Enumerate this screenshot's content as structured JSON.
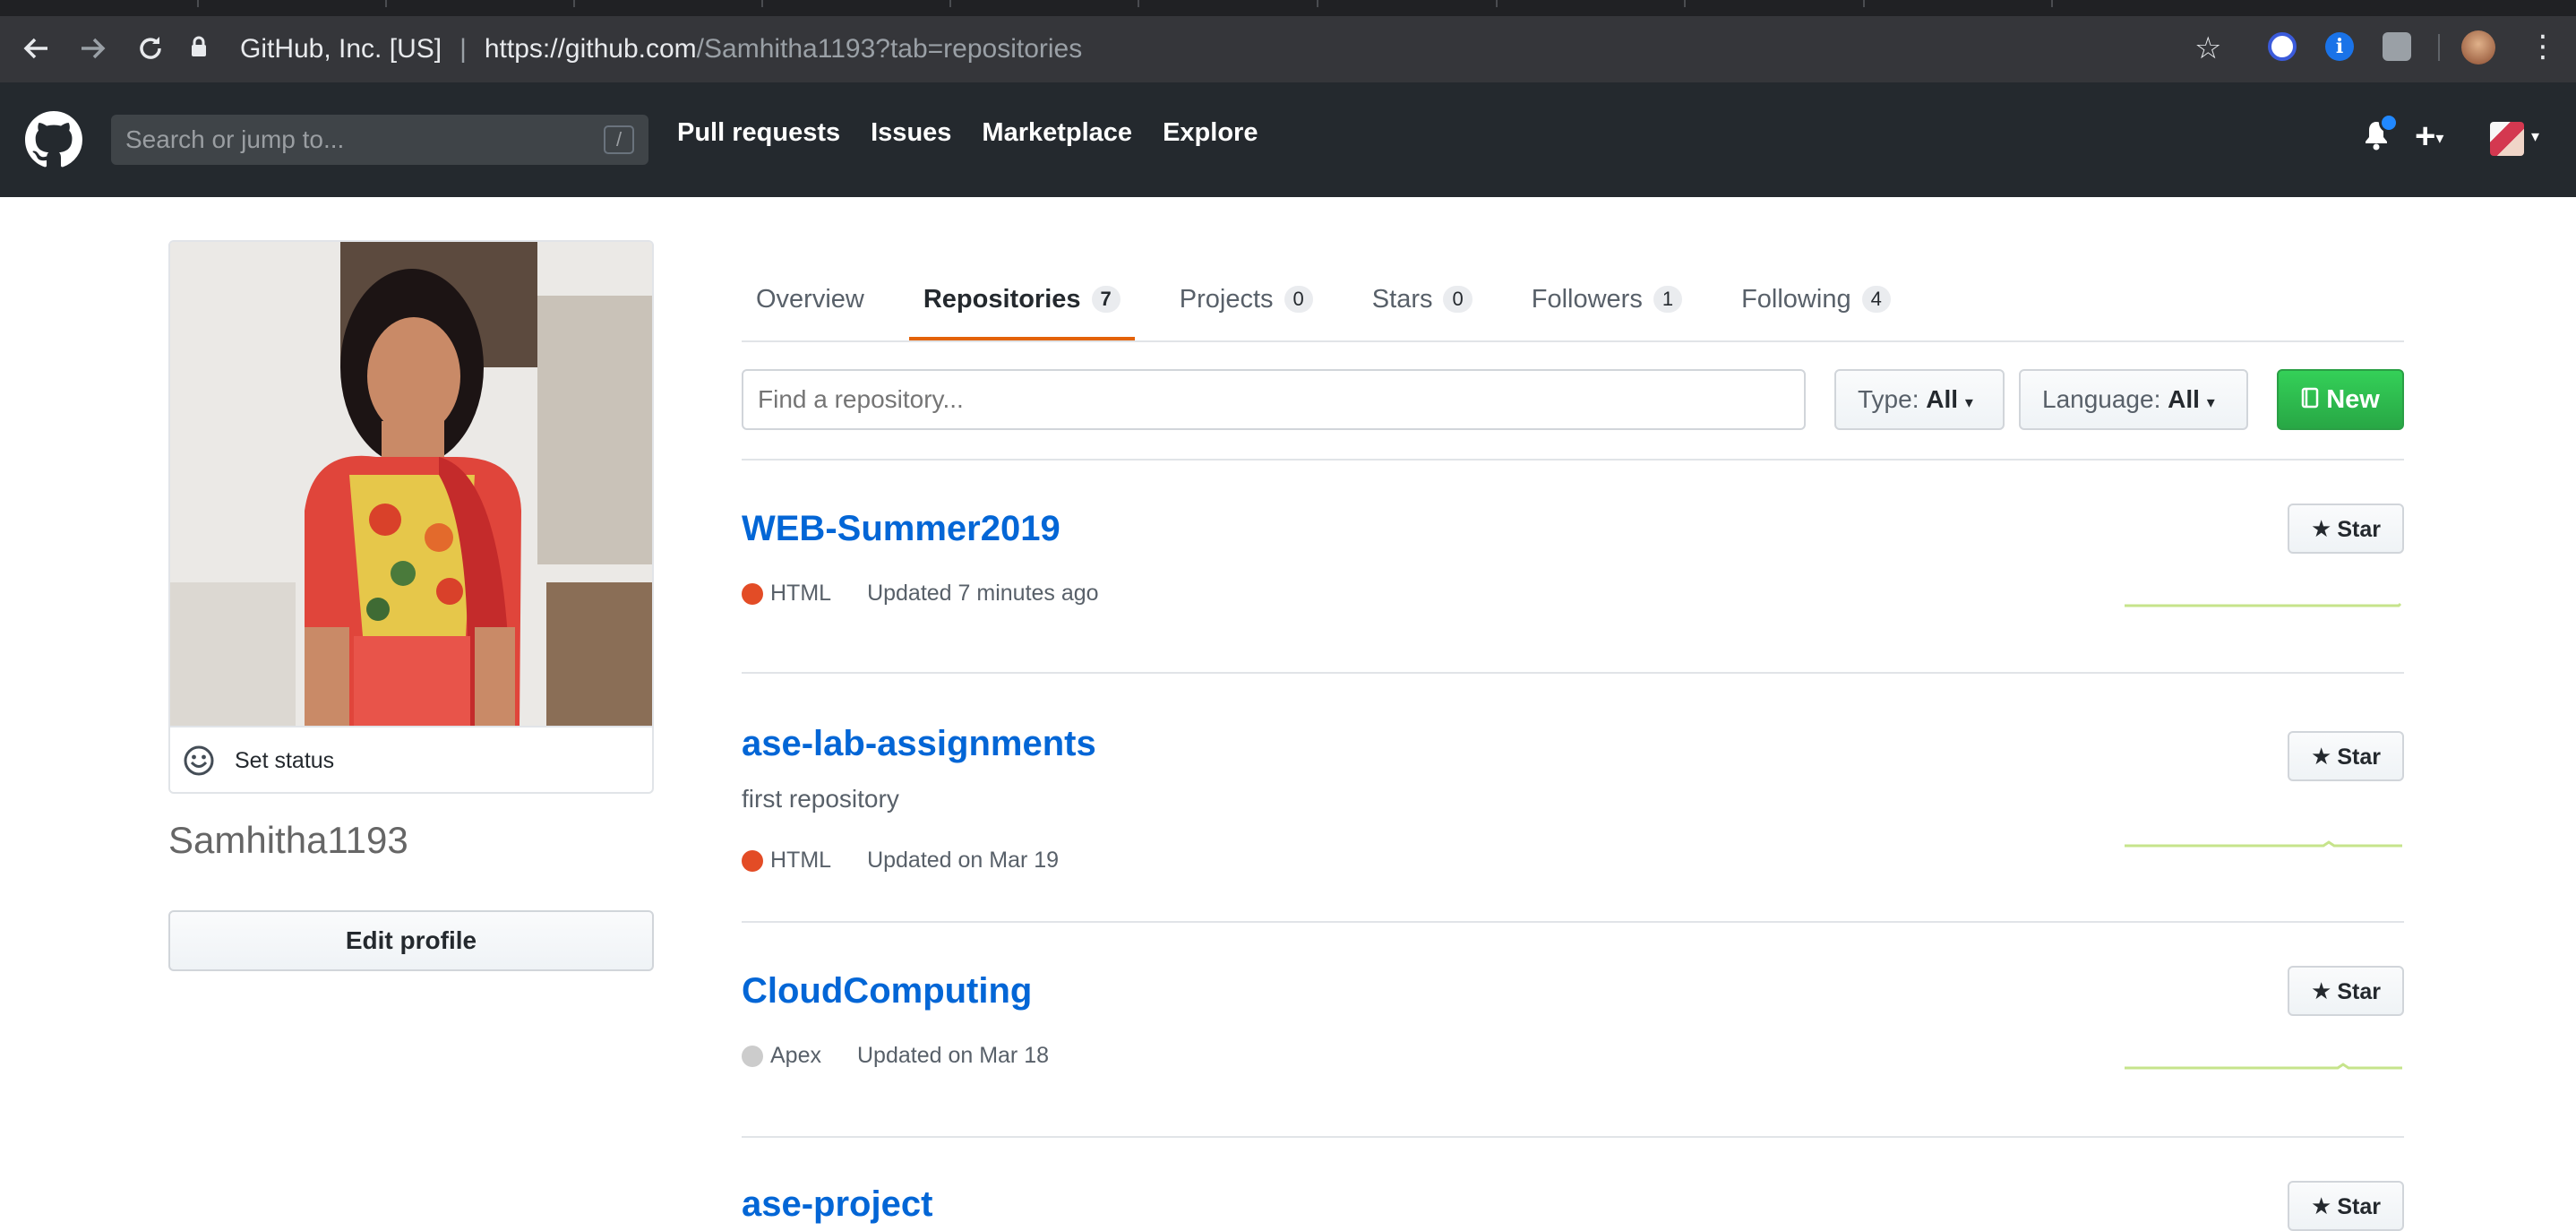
{
  "browser": {
    "site_identity": "GitHub, Inc. [US]",
    "url_host": "https://github.com",
    "url_rest": "/Samhitha1193?tab=repositories",
    "icons": [
      "back-icon",
      "forward-icon",
      "reload-icon",
      "lock-icon",
      "bookmark-star-icon",
      "kebab-menu-icon"
    ]
  },
  "header": {
    "search_placeholder": "Search or jump to...",
    "search_shortcut": "/",
    "nav": [
      "Pull requests",
      "Issues",
      "Marketplace",
      "Explore"
    ],
    "plus_label": "+"
  },
  "profile": {
    "set_status": "Set status",
    "username": "Samhitha1193",
    "edit_profile": "Edit profile"
  },
  "tabs": [
    {
      "label": "Overview",
      "count": null,
      "selected": false
    },
    {
      "label": "Repositories",
      "count": "7",
      "selected": true
    },
    {
      "label": "Projects",
      "count": "0",
      "selected": false
    },
    {
      "label": "Stars",
      "count": "0",
      "selected": false
    },
    {
      "label": "Followers",
      "count": "1",
      "selected": false
    },
    {
      "label": "Following",
      "count": "4",
      "selected": false
    }
  ],
  "filters": {
    "find_placeholder": "Find a repository...",
    "type_label": "Type:",
    "type_value": "All",
    "language_label": "Language:",
    "language_value": "All",
    "new_label": "New"
  },
  "repos": [
    {
      "name": "WEB-Summer2019",
      "description": "",
      "language": "HTML",
      "language_color": "#e34c26",
      "updated": "Updated 7 minutes ago",
      "star_label": "Star"
    },
    {
      "name": "ase-lab-assignments",
      "description": "first repository",
      "language": "HTML",
      "language_color": "#e34c26",
      "updated": "Updated on Mar 19",
      "star_label": "Star"
    },
    {
      "name": "CloudComputing",
      "description": "",
      "language": "Apex",
      "language_color": "#cccccc",
      "updated": "Updated on Mar 18",
      "star_label": "Star"
    },
    {
      "name": "ase-project",
      "description": "",
      "language": "",
      "language_color": "",
      "updated": "",
      "star_label": "Star"
    }
  ],
  "colors": {
    "header_bg": "#24292e",
    "link": "#0366d6",
    "accent_tab": "#e36209",
    "new_button": "#28a745",
    "sparkline": "#c6e48b"
  }
}
